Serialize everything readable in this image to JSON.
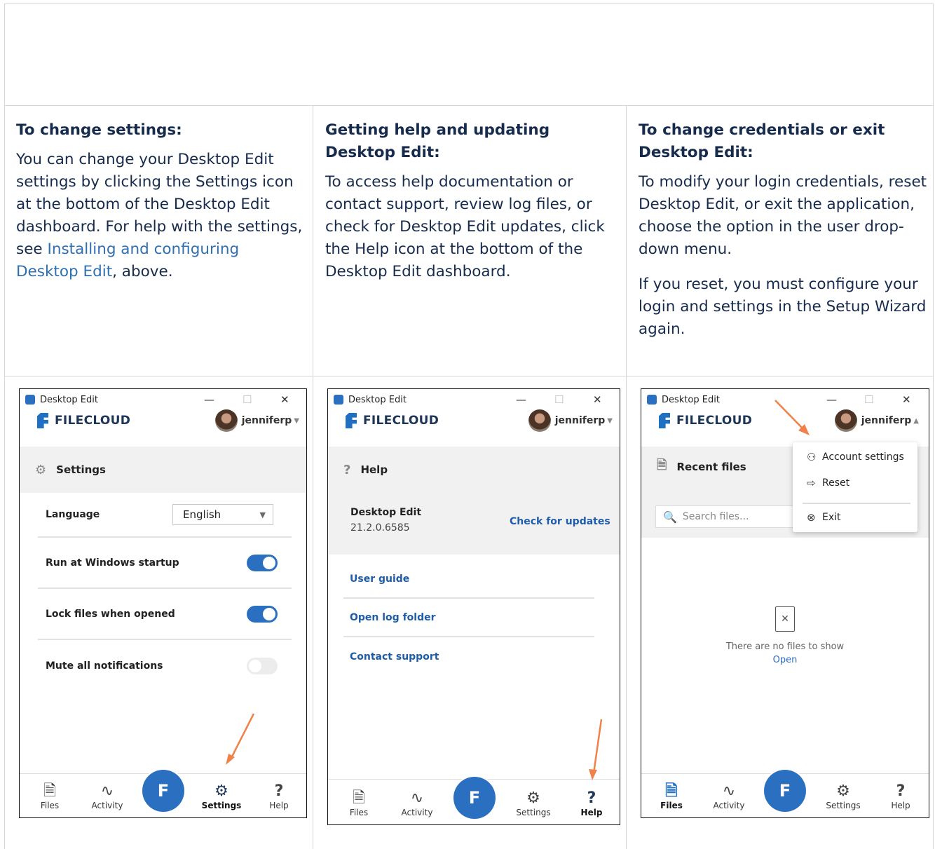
{
  "columns": [
    {
      "heading": "To change settings:",
      "paragraphs": [
        {
          "before": "You can change your Desktop Edit settings by clicking the Settings icon at the bottom of the Desktop Edit dashboard. For help with the settings, see ",
          "link": "Installing and configuring Desktop Edit",
          "after": ", above."
        }
      ]
    },
    {
      "heading": "Getting help and updating Desktop Edit:",
      "paragraphs": [
        {
          "text": "To access help documentation or contact support, review log files, or check for Desktop Edit updates, click the Help icon at the bottom of the Desktop Edit dashboard."
        }
      ]
    },
    {
      "heading": "To change credentials or exit Desktop Edit:",
      "paragraphs": [
        {
          "text": "To modify your login credentials, reset Desktop Edit, or exit the application, choose the option in the user drop-down menu."
        },
        {
          "text": "If you reset, you must configure your login and settings in the Setup Wizard again."
        }
      ]
    }
  ],
  "window": {
    "title": "Desktop Edit",
    "minimize": "—",
    "maximize": "☐",
    "close": "✕",
    "brand": "FILECLOUD",
    "username": "jenniferp"
  },
  "settings_screen": {
    "section_title": "Settings",
    "language_label": "Language",
    "language_value": "English",
    "rows": [
      {
        "label": "Run at Windows startup",
        "on": true
      },
      {
        "label": "Lock files when opened",
        "on": true
      },
      {
        "label": "Mute all notifications",
        "on": false
      }
    ]
  },
  "help_screen": {
    "section_title": "Help",
    "product_name": "Desktop Edit",
    "version": "21.2.0.6585",
    "update_link": "Check for updates",
    "links": [
      "User guide",
      "Open log folder",
      "Contact support"
    ]
  },
  "files_screen": {
    "section_title": "Recent files",
    "search_placeholder": "Search files...",
    "empty_text": "There are no files to show",
    "empty_link": "Open",
    "menu": {
      "account_settings": "Account settings",
      "reset": "Reset",
      "exit": "Exit"
    }
  },
  "bottom_nav": {
    "files": "Files",
    "activity": "Activity",
    "settings": "Settings",
    "help": "Help"
  },
  "icons": {
    "settings": "gear-icon",
    "help": "question-icon",
    "files": "document-icon",
    "activity": "pulse-icon",
    "arrow_color": "#f0814a",
    "accent": "#2a6fc0"
  }
}
